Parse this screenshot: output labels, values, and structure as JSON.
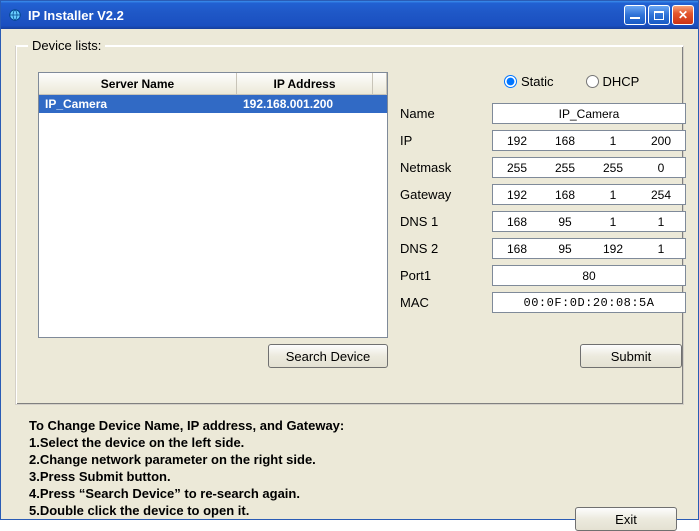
{
  "title": "IP Installer V2.2",
  "group_label": "Device lists:",
  "list": {
    "header_name": "Server Name",
    "header_ip": "IP Address",
    "rows": [
      {
        "name": "IP_Camera",
        "ip": "192.168.001.200",
        "selected": true
      }
    ]
  },
  "buttons": {
    "search": "Search Device",
    "submit": "Submit",
    "exit": "Exit"
  },
  "radios": {
    "static": "Static",
    "dhcp": "DHCP",
    "selected": "static"
  },
  "form": {
    "name_label": "Name",
    "name_value": "IP_Camera",
    "ip_label": "IP",
    "ip": [
      "192",
      "168",
      "1",
      "200"
    ],
    "netmask_label": "Netmask",
    "netmask": [
      "255",
      "255",
      "255",
      "0"
    ],
    "gateway_label": "Gateway",
    "gateway": [
      "192",
      "168",
      "1",
      "254"
    ],
    "dns1_label": "DNS 1",
    "dns1": [
      "168",
      "95",
      "1",
      "1"
    ],
    "dns2_label": "DNS 2",
    "dns2": [
      "168",
      "95",
      "192",
      "1"
    ],
    "port_label": "Port1",
    "port_value": "80",
    "mac_label": "MAC",
    "mac_value": "00:0F:0D:20:08:5A"
  },
  "instructions": [
    "To Change Device Name, IP address, and Gateway:",
    "1.Select the device on the left side.",
    "2.Change network parameter on the right side.",
    "3.Press Submit button.",
    "4.Press “Search Device” to re-search again.",
    "5.Double click the device to open it."
  ]
}
